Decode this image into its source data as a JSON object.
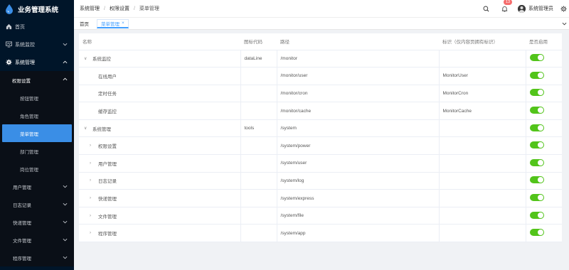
{
  "app": {
    "title": "业务管理系统"
  },
  "sidebar": {
    "items": [
      {
        "label": "首页",
        "icon": "home-icon"
      },
      {
        "label": "系统监控",
        "icon": "monitor-icon"
      },
      {
        "label": "系统管理",
        "icon": "settings-icon"
      }
    ],
    "submenu_parent": "权限设置",
    "submenu_items": [
      "按钮管理",
      "角色管理",
      "菜单管理",
      "部门管理",
      "岗位管理"
    ],
    "selected": "菜单管理",
    "other_items": [
      "用户管理",
      "日志记录",
      "快递管理",
      "文件管理",
      "程序管理"
    ]
  },
  "breadcrumb": [
    "系统管理",
    "权限设置",
    "菜单管理"
  ],
  "header": {
    "notification_count": "13",
    "username": "系统管理员"
  },
  "tabs": [
    {
      "label": "首页",
      "active": false
    },
    {
      "label": "菜单管理",
      "active": true,
      "close": "×"
    }
  ],
  "table": {
    "headers": [
      "名称",
      "图标代码",
      "路径",
      "标识（仅内容页拥有标识）",
      "是否启用"
    ],
    "rows": [
      {
        "name": "系统监控",
        "arrow": "∨",
        "level": 0,
        "icon": "dataLine",
        "path": "/monitor",
        "ident": "",
        "enabled": true
      },
      {
        "name": "在线用户",
        "arrow": "",
        "level": 1,
        "icon": "",
        "path": "/monitor/user",
        "ident": "MonitorUser",
        "enabled": true
      },
      {
        "name": "定时任务",
        "arrow": "",
        "level": 1,
        "icon": "",
        "path": "/monitor/cron",
        "ident": "MonitorCron",
        "enabled": true
      },
      {
        "name": "缓存监控",
        "arrow": "",
        "level": 1,
        "icon": "",
        "path": "/monitor/cache",
        "ident": "MonitorCache",
        "enabled": true
      },
      {
        "name": "系统管理",
        "arrow": "∨",
        "level": 0,
        "icon": "tools",
        "path": "/system",
        "ident": "",
        "enabled": true
      },
      {
        "name": "权限设置",
        "arrow": "›",
        "level": 1,
        "icon": "",
        "path": "/system/power",
        "ident": "",
        "enabled": true
      },
      {
        "name": "用户管理",
        "arrow": "›",
        "level": 1,
        "icon": "",
        "path": "/system/user",
        "ident": "",
        "enabled": true
      },
      {
        "name": "日志记录",
        "arrow": "›",
        "level": 1,
        "icon": "",
        "path": "/system/log",
        "ident": "",
        "enabled": true
      },
      {
        "name": "快递管理",
        "arrow": "›",
        "level": 1,
        "icon": "",
        "path": "/system/express",
        "ident": "",
        "enabled": true
      },
      {
        "name": "文件管理",
        "arrow": "›",
        "level": 1,
        "icon": "",
        "path": "/system/file",
        "ident": "",
        "enabled": true
      },
      {
        "name": "程序管理",
        "arrow": "›",
        "level": 1,
        "icon": "",
        "path": "/system/app",
        "ident": "",
        "enabled": true
      }
    ]
  },
  "colors": {
    "sidebar_bg": "#001529",
    "accent": "#409eff",
    "switch_on": "#52c41a",
    "badge": "#f56c6c"
  }
}
